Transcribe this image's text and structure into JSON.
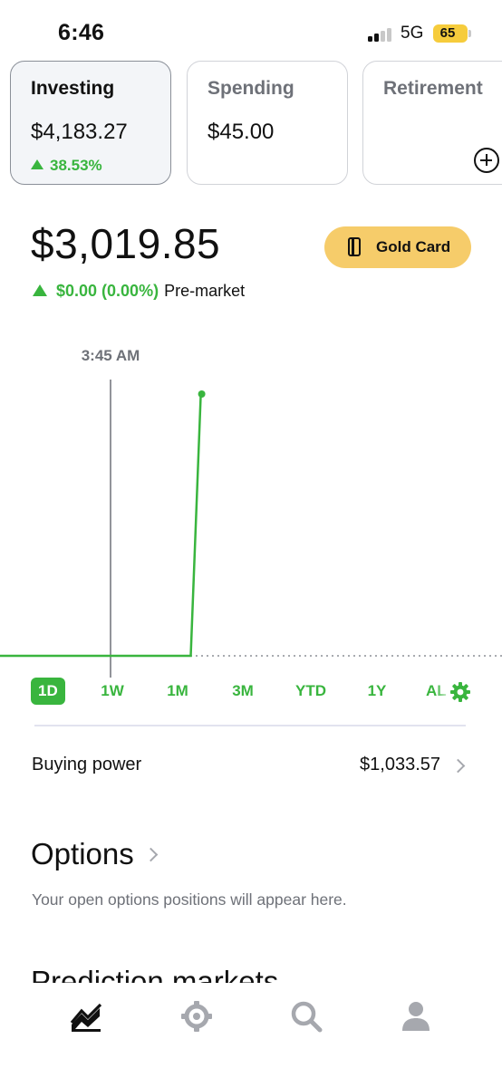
{
  "status_bar": {
    "time": "6:46",
    "network": "5G",
    "battery": "65",
    "accent": "#f6cc3c"
  },
  "accounts": [
    {
      "title": "Investing",
      "value": "$4,183.27",
      "change": "38.53%",
      "selected": true
    },
    {
      "title": "Spending",
      "value": "$45.00",
      "selected": false
    },
    {
      "title": "Retirement",
      "selected": false,
      "icon": "plus-circle-icon"
    }
  ],
  "portfolio": {
    "value": "$3,019.85",
    "change": "$0.00 (0.00%)",
    "session": "Pre-market",
    "gold_button": "Gold Card",
    "gold_color": "#f6cc6a"
  },
  "chart_data": {
    "type": "line",
    "cursor_label": "3:45 AM",
    "baseline": "dotted",
    "series": [
      {
        "color": "#39b53e",
        "x": [
          0,
          0.38,
          0.4
        ],
        "y": [
          0,
          0,
          1
        ]
      }
    ]
  },
  "ranges": {
    "tabs": [
      "1D",
      "1W",
      "1M",
      "3M",
      "YTD",
      "1Y",
      "AL"
    ],
    "selected": "1D",
    "accent": "#39b53e"
  },
  "buying_power": {
    "label": "Buying power",
    "value": "$1,033.57"
  },
  "options": {
    "title": "Options",
    "subtitle": "Your open options positions will appear here."
  },
  "prediction": {
    "title": "Prediction markets"
  },
  "nav": {
    "items": [
      "investing-chart-icon",
      "crypto-icon",
      "search-icon",
      "account-icon"
    ]
  }
}
